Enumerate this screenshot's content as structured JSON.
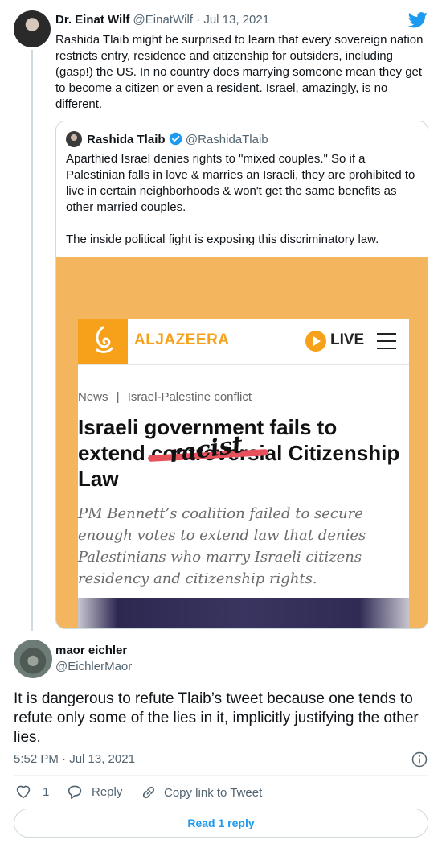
{
  "tweet": {
    "author_name": "Dr. Einat Wilf",
    "handle": "@EinatWilf",
    "separator": "·",
    "date": "Jul 13, 2021",
    "text": "Rashida Tlaib might be surprised to learn that every sovereign nation restricts entry, residence and citizenship for outsiders, including (gasp!) the US. In no country does marrying someone mean they get to become a citizen or even a resident. Israel, amazingly, is no different."
  },
  "quoted": {
    "author_name": "Rashida Tlaib",
    "handle": "@RashidaTlaib",
    "text1": "Aparthied Israel denies rights to \"mixed couples.\" So if a Palestinian falls in love & marries an Israeli, they are prohibited to live in certain neighborhoods & won't get the same benefits as other married couples.",
    "text2": "The inside political fight is exposing this discriminatory law."
  },
  "article": {
    "brand": "ALJAZEERA",
    "live": "LIVE",
    "crumb_news": "News",
    "crumb_sep": "|",
    "crumb_topic": "Israel-Palestine conflict",
    "headline_1": "Israeli government fails to",
    "headline_extend": "extend",
    "headline_struck": "controversial",
    "headline_rest": " Citizenship",
    "headline_3": "Law",
    "overlay": "racist",
    "dek": "PM Bennett’s coalition failed to secure enough votes to extend law that denies Palestinians who marry Israeli citizens residency and citizenship rights."
  },
  "reply": {
    "author_name": "maor eichler",
    "handle": "@EichlerMaor",
    "text": "It is dangerous to refute Tlaib’s tweet because one tends to refute only some of the lies in it, implicitly justifying the other lies.",
    "timestamp": "5:52 PM · Jul 13, 2021",
    "like_count": "1",
    "reply_label": "Reply",
    "copy_label": "Copy link to Tweet",
    "read_replies": "Read 1 reply"
  },
  "colors": {
    "accent": "#1d9bf0",
    "brand": "#f7a11a",
    "verified": "#1d9bf0"
  }
}
